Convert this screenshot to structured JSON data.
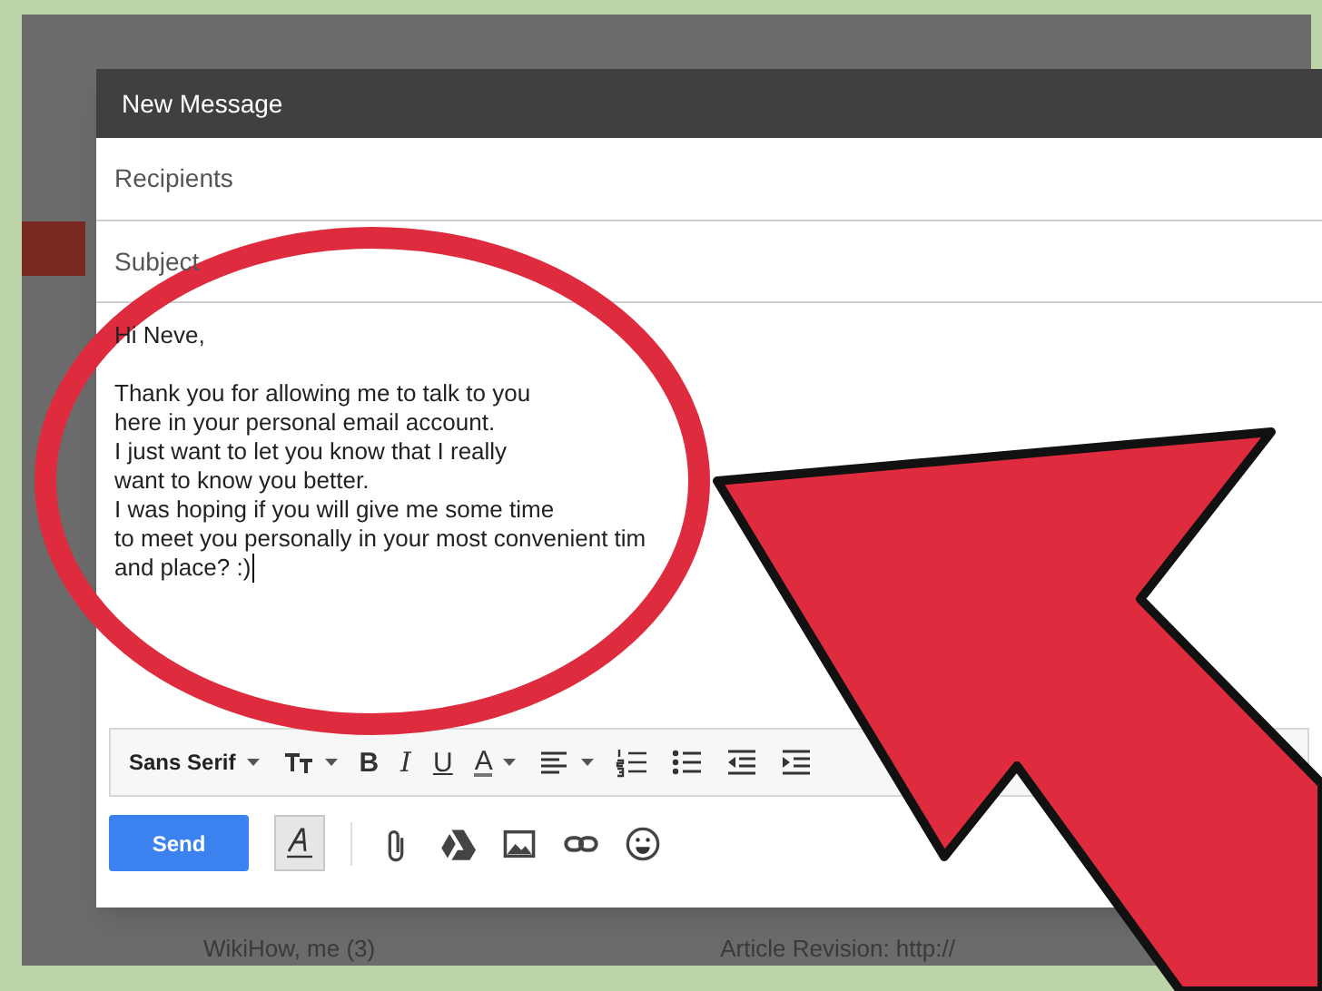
{
  "compose": {
    "title": "New Message",
    "recipients_placeholder": "Recipients",
    "subject_placeholder": "Subject",
    "greeting": "Hi Neve,",
    "body_lines": [
      "Thank you for allowing me to talk to you",
      "here in your personal email account.",
      "I just want to let you know that I really",
      "want to know you better.",
      "I was hoping if you will give me some time",
      "to meet you personally in your most convenient tim",
      "and place? :)"
    ],
    "toolbar": [
      {
        "kind": "font",
        "label": "Sans Serif"
      },
      {
        "kind": "size"
      },
      {
        "kind": "bold",
        "label": "B"
      },
      {
        "kind": "italic",
        "label": "I"
      },
      {
        "kind": "underline",
        "label": "U"
      },
      {
        "kind": "color",
        "label": "A"
      },
      {
        "kind": "align"
      },
      {
        "kind": "numbered"
      },
      {
        "kind": "bulleted"
      },
      {
        "kind": "outdent"
      },
      {
        "kind": "indent"
      }
    ],
    "send_label": "Send",
    "formatting_selected": true,
    "actions": [
      {
        "kind": "attach"
      },
      {
        "kind": "drive"
      },
      {
        "kind": "photo"
      },
      {
        "kind": "link"
      },
      {
        "kind": "emoji"
      }
    ]
  },
  "background_rows": [
    {
      "sender": "WikiHow, me (3)",
      "subject": "Article Revision: http://"
    }
  ]
}
